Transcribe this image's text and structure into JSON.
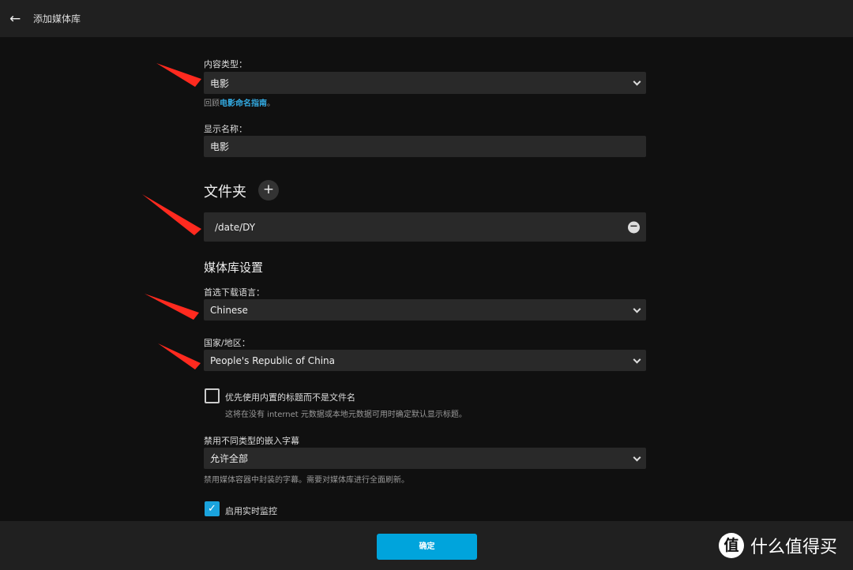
{
  "header": {
    "title": "添加媒体库",
    "back_icon": "arrow-left-icon"
  },
  "content_type": {
    "label": "内容类型：",
    "value": "电影",
    "help_prefix": "回顾",
    "help_link": "电影命名指南",
    "help_suffix": "。"
  },
  "display_name": {
    "label": "显示名称：",
    "value": "电影"
  },
  "folders": {
    "heading": "文件夹",
    "add_icon": "plus-icon",
    "items": [
      {
        "path": "/date/DY",
        "remove_icon": "minus-circle-icon"
      }
    ]
  },
  "library_settings": {
    "heading": "媒体库设置"
  },
  "language": {
    "label": "首选下载语言：",
    "value": "Chinese"
  },
  "country": {
    "label": "国家/地区：",
    "value": "People's Republic of China"
  },
  "prefer_embedded_titles": {
    "label": "优先使用内置的标题而不是文件名",
    "help": "这将在没有 internet 元数据或本地元数据可用时确定默认显示标题。",
    "checked": false
  },
  "subtitles": {
    "label": "禁用不同类型的嵌入字幕",
    "value": "允许全部",
    "help": "禁用媒体容器中封装的字幕。需要对媒体库进行全面刷新。"
  },
  "realtime_monitor": {
    "label": "启用实时监控",
    "checked": true
  },
  "footer": {
    "ok_label": "确定"
  },
  "watermark": {
    "logo_text": "值",
    "text": "什么值得买"
  },
  "colors": {
    "accent": "#00a4dc",
    "link": "#33a9e0",
    "annotation_arrow": "#ff2a1f"
  }
}
